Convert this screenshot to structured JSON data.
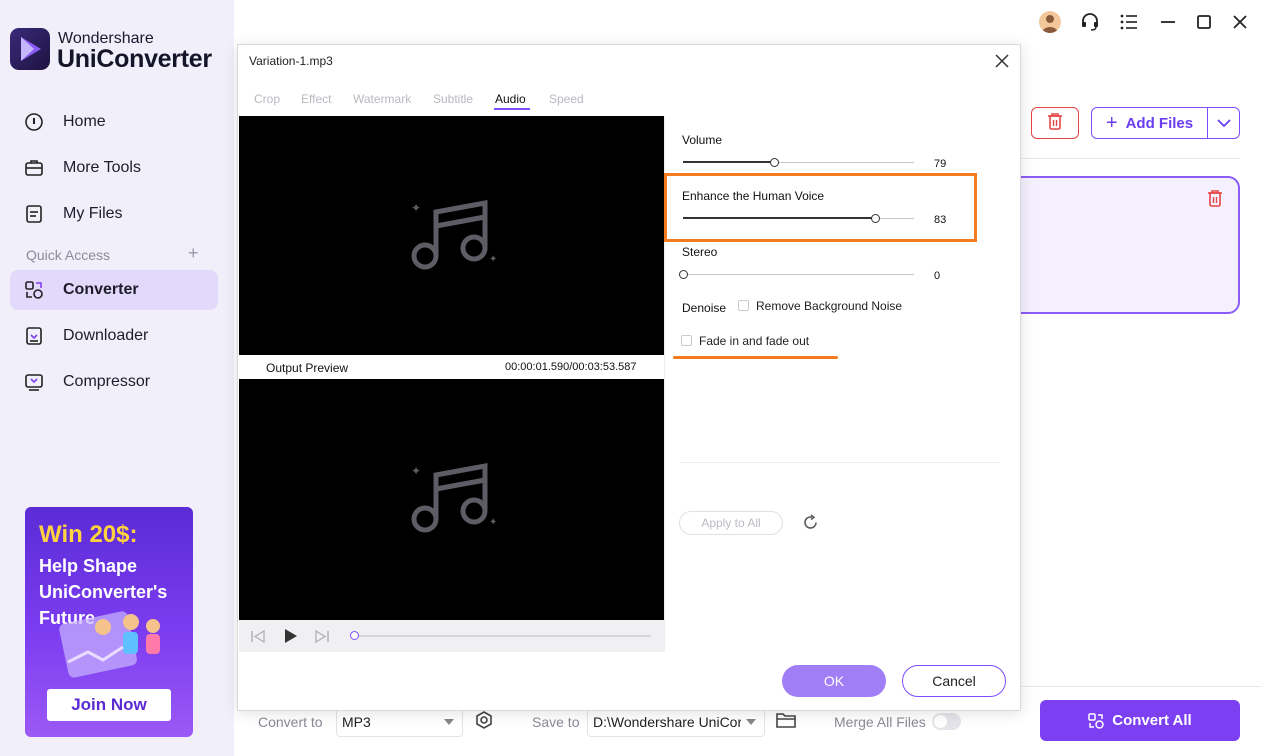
{
  "app": {
    "brand_small": "Wondershare",
    "brand_big": "UniConverter"
  },
  "sidebar": {
    "items": [
      {
        "label": "Home",
        "icon": "home-icon"
      },
      {
        "label": "More Tools",
        "icon": "toolbox-icon"
      },
      {
        "label": "My Files",
        "icon": "files-icon"
      }
    ],
    "quick_access_label": "Quick Access",
    "quick_items": [
      {
        "label": "Converter",
        "icon": "converter-icon",
        "active": true
      },
      {
        "label": "Downloader",
        "icon": "downloader-icon"
      },
      {
        "label": "Compressor",
        "icon": "compressor-icon"
      }
    ]
  },
  "promo": {
    "title": "Win 20$:",
    "subtitle": "Help Shape UniConverter's Future",
    "button": "Join Now"
  },
  "toolbar": {
    "add_files": "Add Files"
  },
  "dialog": {
    "title": "Variation-1.mp3",
    "tabs": [
      "Crop",
      "Effect",
      "Watermark",
      "Subtitle",
      "Audio",
      "Speed"
    ],
    "active_tab": "Audio",
    "output_preview_label": "Output Preview",
    "output_time": "00:00:01.590/00:03:53.587",
    "volume": {
      "label": "Volume",
      "value": "79"
    },
    "enhance": {
      "label": "Enhance the Human Voice",
      "value": "83"
    },
    "stereo": {
      "label": "Stereo",
      "value": "0"
    },
    "denoise_label": "Denoise",
    "remove_noise_label": "Remove Background Noise",
    "fade_label": "Fade in and fade out",
    "apply_all": "Apply to All",
    "ok": "OK",
    "cancel": "Cancel"
  },
  "bottom": {
    "convert_to_label": "Convert to",
    "convert_to_value": "MP3",
    "save_to_label": "Save to",
    "save_to_value": "D:\\Wondershare UniCor",
    "merge_label": "Merge All Files",
    "convert_all": "Convert All"
  },
  "colors": {
    "accent": "#7c3ff2",
    "highlight": "#f47b20",
    "danger": "#e64545"
  }
}
